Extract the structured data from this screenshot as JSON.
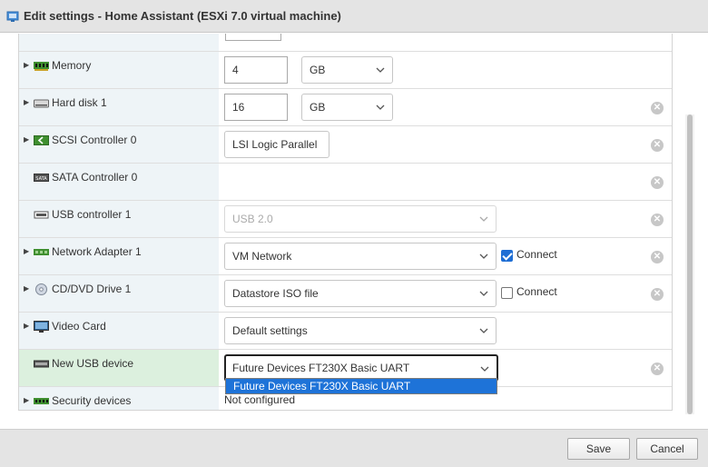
{
  "dialog": {
    "title": "Edit settings - Home Assistant (ESXi 7.0 virtual machine)"
  },
  "rows": {
    "memory": {
      "label": "Memory",
      "value": "4",
      "unit": "GB",
      "icon": "memory-icon"
    },
    "hard_disk": {
      "label": "Hard disk 1",
      "value": "16",
      "unit": "GB",
      "icon": "hard-disk-icon"
    },
    "scsi": {
      "label": "SCSI Controller 0",
      "value": "LSI Logic Parallel",
      "icon": "scsi-controller-icon"
    },
    "sata": {
      "label": "SATA Controller 0",
      "icon": "sata-controller-icon"
    },
    "usb_controller": {
      "label": "USB controller 1",
      "value": "USB 2.0",
      "icon": "usb-icon"
    },
    "network": {
      "label": "Network Adapter 1",
      "value": "VM Network",
      "connect_label": "Connect",
      "connect_checked": true,
      "icon": "network-adapter-icon"
    },
    "cdrom": {
      "label": "CD/DVD Drive 1",
      "value": "Datastore ISO file",
      "connect_label": "Connect",
      "connect_checked": false,
      "icon": "cd-dvd-icon"
    },
    "video": {
      "label": "Video Card",
      "value": "Default settings",
      "icon": "video-card-icon"
    },
    "new_usb": {
      "label": "New USB device",
      "value": "Future Devices FT230X Basic UART",
      "icon": "usb-device-icon"
    },
    "security": {
      "label": "Security devices",
      "value": "Not configured",
      "icon": "security-device-icon"
    }
  },
  "dropdown": {
    "options": [
      "Future Devices FT230X Basic UART"
    ]
  },
  "footer": {
    "save_label": "Save",
    "cancel_label": "Cancel"
  },
  "colors": {
    "label_bg": "#eef4f7",
    "selected_label_bg": "#dcf0de",
    "highlight": "#1e73d8"
  }
}
